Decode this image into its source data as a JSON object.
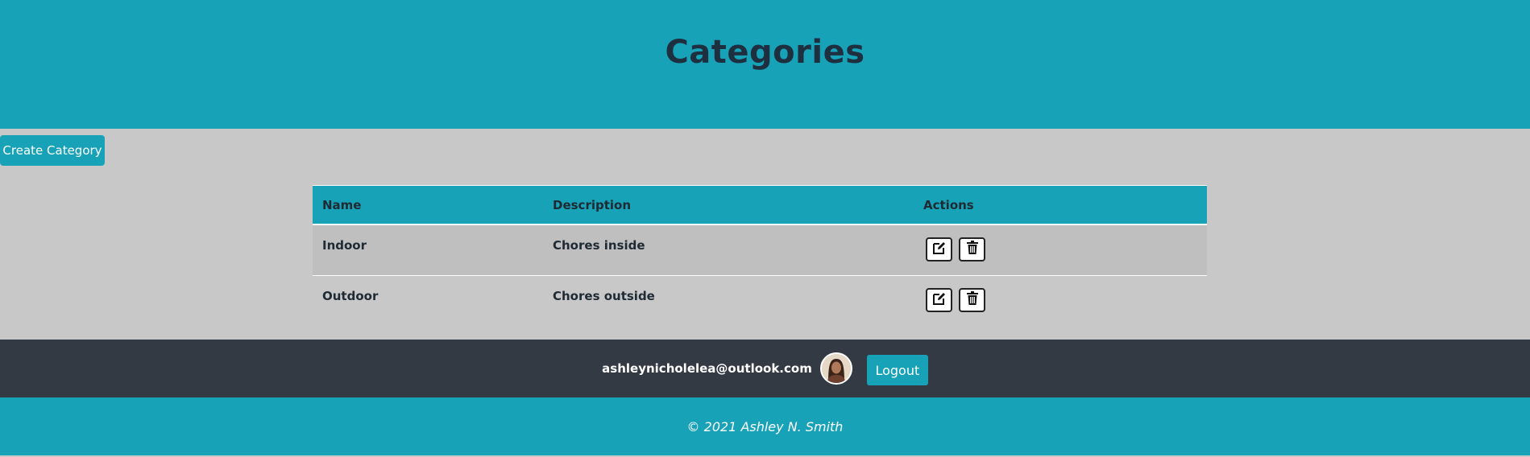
{
  "header": {
    "title": "Categories"
  },
  "toolbar": {
    "create_label": "Create Category"
  },
  "table": {
    "columns": [
      "Name",
      "Description",
      "Actions"
    ],
    "rows": [
      {
        "name": "Indoor",
        "description": "Chores inside"
      },
      {
        "name": "Outdoor",
        "description": "Chores outside"
      }
    ],
    "row_actions": [
      "edit-icon",
      "trash-icon"
    ]
  },
  "user": {
    "email": "ashleynicholelea@outlook.com",
    "logout_label": "Logout"
  },
  "footer": {
    "copyright": "© 2021 Ashley N. Smith"
  },
  "colors": {
    "accent": "#17a2b8",
    "dark_bar": "#343a44",
    "page_bg": "#c8c8c8"
  }
}
